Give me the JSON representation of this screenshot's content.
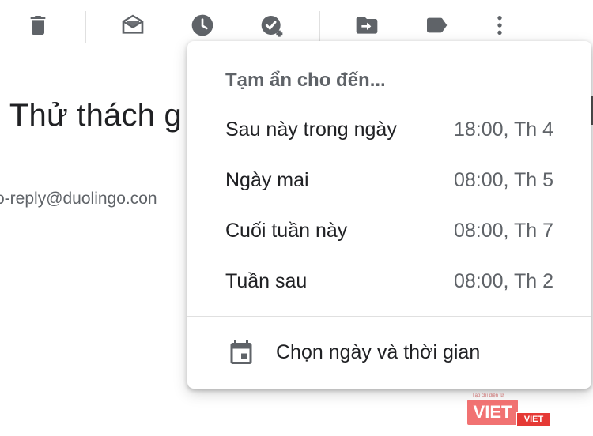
{
  "toolbar": {
    "icons": [
      "delete-icon",
      "mark-unread-icon",
      "snooze-icon",
      "add-task-icon",
      "move-to-icon",
      "label-icon",
      "more-vert-icon"
    ],
    "icon_color": "#5f6368"
  },
  "email": {
    "subject_fragment": ": Thử thách g",
    "sender_fragment": "o-reply@duolingo.con"
  },
  "snooze_menu": {
    "title": "Tạm ẩn cho đến...",
    "items": [
      {
        "label": "Sau này trong ngày",
        "time": "18:00, Th 4"
      },
      {
        "label": "Ngày mai",
        "time": "08:00, Th 5"
      },
      {
        "label": "Cuối tuần này",
        "time": "08:00, Th 7"
      },
      {
        "label": "Tuần sau",
        "time": "08:00, Th 2"
      }
    ],
    "pick_label": "Chọn ngày và thời gian"
  },
  "watermark": {
    "brand": "VIET",
    "tag": "VIET",
    "small_text": "Tạp chí điện tử"
  }
}
